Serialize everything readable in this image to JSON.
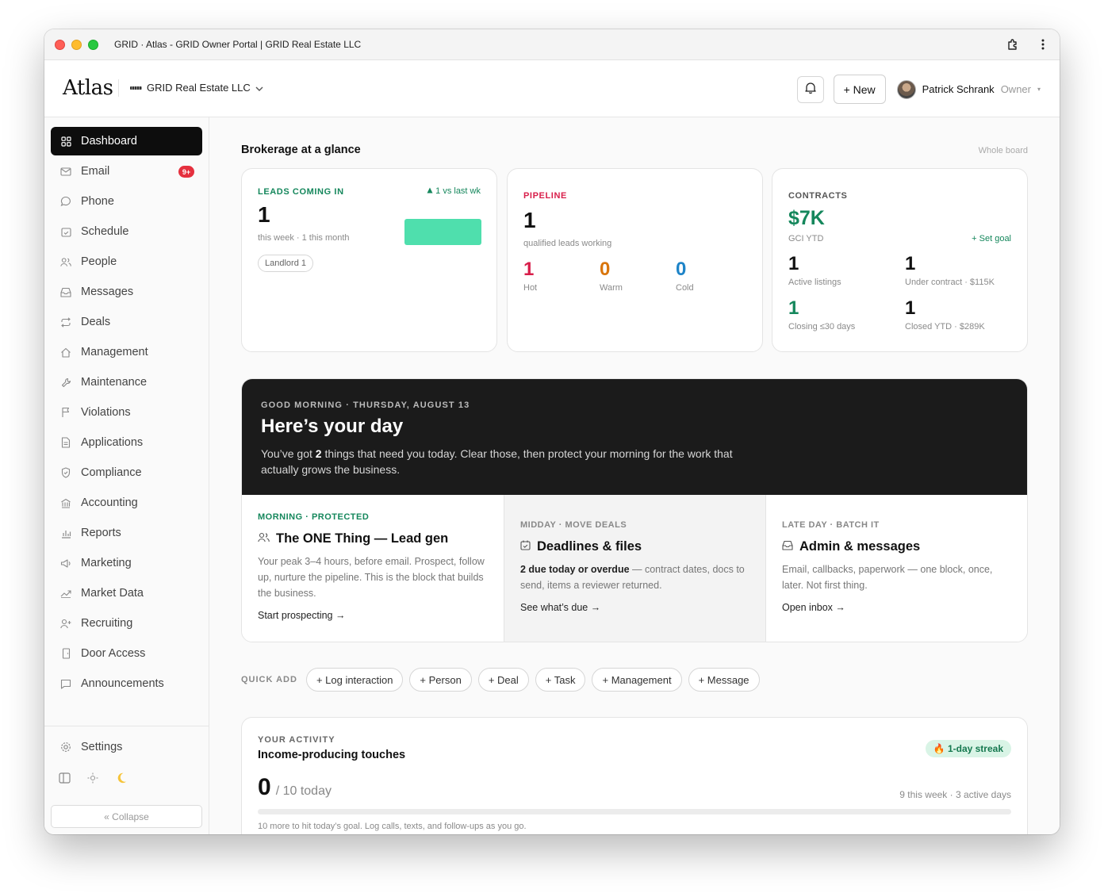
{
  "window": {
    "title": "GRID · Atlas - GRID Owner Portal | GRID Real Estate LLC"
  },
  "header": {
    "logo": "Atlas",
    "org_name": "GRID Real Estate LLC",
    "new_label": "+ New",
    "user_name": "Patrick Schrank",
    "user_role": "Owner"
  },
  "sidebar": {
    "items": [
      {
        "label": "Dashboard",
        "icon": "grid-icon"
      },
      {
        "label": "Email",
        "icon": "mail-icon",
        "badge": "9+"
      },
      {
        "label": "Phone",
        "icon": "chat-bubble-icon"
      },
      {
        "label": "Schedule",
        "icon": "calendar-check-icon"
      },
      {
        "label": "People",
        "icon": "people-icon"
      },
      {
        "label": "Messages",
        "icon": "inbox-icon"
      },
      {
        "label": "Deals",
        "icon": "repeat-icon"
      },
      {
        "label": "Management",
        "icon": "home-icon"
      },
      {
        "label": "Maintenance",
        "icon": "wrench-icon"
      },
      {
        "label": "Violations",
        "icon": "flag-icon"
      },
      {
        "label": "Applications",
        "icon": "document-icon"
      },
      {
        "label": "Compliance",
        "icon": "shield-icon"
      },
      {
        "label": "Accounting",
        "icon": "bank-icon"
      },
      {
        "label": "Reports",
        "icon": "bar-chart-icon"
      },
      {
        "label": "Marketing",
        "icon": "megaphone-icon"
      },
      {
        "label": "Market Data",
        "icon": "trend-icon"
      },
      {
        "label": "Recruiting",
        "icon": "user-plus-icon"
      },
      {
        "label": "Door Access",
        "icon": "door-icon"
      },
      {
        "label": "Announcements",
        "icon": "message-square-icon"
      }
    ],
    "settings_label": "Settings",
    "collapse_label": "« Collapse"
  },
  "main": {
    "section_title": "Brokerage at a glance",
    "whole_board": "Whole board",
    "leads": {
      "label": "LEADS COMING IN",
      "trend": "1 vs last wk",
      "value": "1",
      "sub": "this week · 1 this month",
      "tag": "Landlord 1"
    },
    "pipeline": {
      "label": "PIPELINE",
      "value": "1",
      "sub": "qualified leads working",
      "hot_value": "1",
      "hot_label": "Hot",
      "warm_value": "0",
      "warm_label": "Warm",
      "cold_value": "0",
      "cold_label": "Cold"
    },
    "contracts": {
      "label": "CONTRACTS",
      "gci": "$7K",
      "gci_label": "GCI YTD",
      "set_goal": "+ Set goal",
      "active_value": "1",
      "active_label": "Active listings",
      "under_value": "1",
      "under_label": "Under contract · $115K",
      "closing_value": "1",
      "closing_label": "Closing ≤30 days",
      "closed_value": "1",
      "closed_label": "Closed YTD · $289K"
    },
    "day": {
      "eyebrow": "GOOD MORNING · THURSDAY, AUGUST 13",
      "title": "Here’s your day",
      "desc_pre": "You’ve got ",
      "desc_count": "2",
      "desc_post": " things that need you today. Clear those, then protect your morning for the work that actually grows the business.",
      "col1": {
        "eyebrow": "MORNING · PROTECTED",
        "title": "The ONE Thing — Lead gen",
        "desc": "Your peak 3–4 hours, before email. Prospect, follow up, nurture the pipeline. This is the block that builds the business.",
        "link": "Start prospecting →"
      },
      "col2": {
        "eyebrow": "MIDDAY · MOVE DEALS",
        "title": "Deadlines & files",
        "desc_bold": "2 due today or overdue",
        "desc_rest": " — contract dates, docs to send, items a reviewer returned.",
        "link": "See what’s due →"
      },
      "col3": {
        "eyebrow": "LATE DAY · BATCH IT",
        "title": "Admin & messages",
        "desc": "Email, callbacks, paperwork — one block, once, later. Not first thing.",
        "link": "Open inbox →"
      }
    },
    "quick_add": {
      "label": "QUICK ADD",
      "items": [
        "+ Log interaction",
        "+ Person",
        "+ Deal",
        "+ Task",
        "+ Management",
        "+ Message"
      ]
    },
    "activity": {
      "eyebrow": "YOUR ACTIVITY",
      "title": "Income-producing touches",
      "streak": "🔥 1-day streak",
      "count": "0",
      "goal": "/ 10 today",
      "week": "9 this week · 3 active days",
      "progress": 0,
      "note": "10 more to hit today’s goal. Log calls, texts, and follow-ups as you go."
    }
  },
  "colors": {
    "accent_green": "#15875c",
    "hot": "#d81e4a",
    "warm": "#d9750c",
    "cold": "#1e84c8",
    "leads_bar": "#4fdfad"
  }
}
